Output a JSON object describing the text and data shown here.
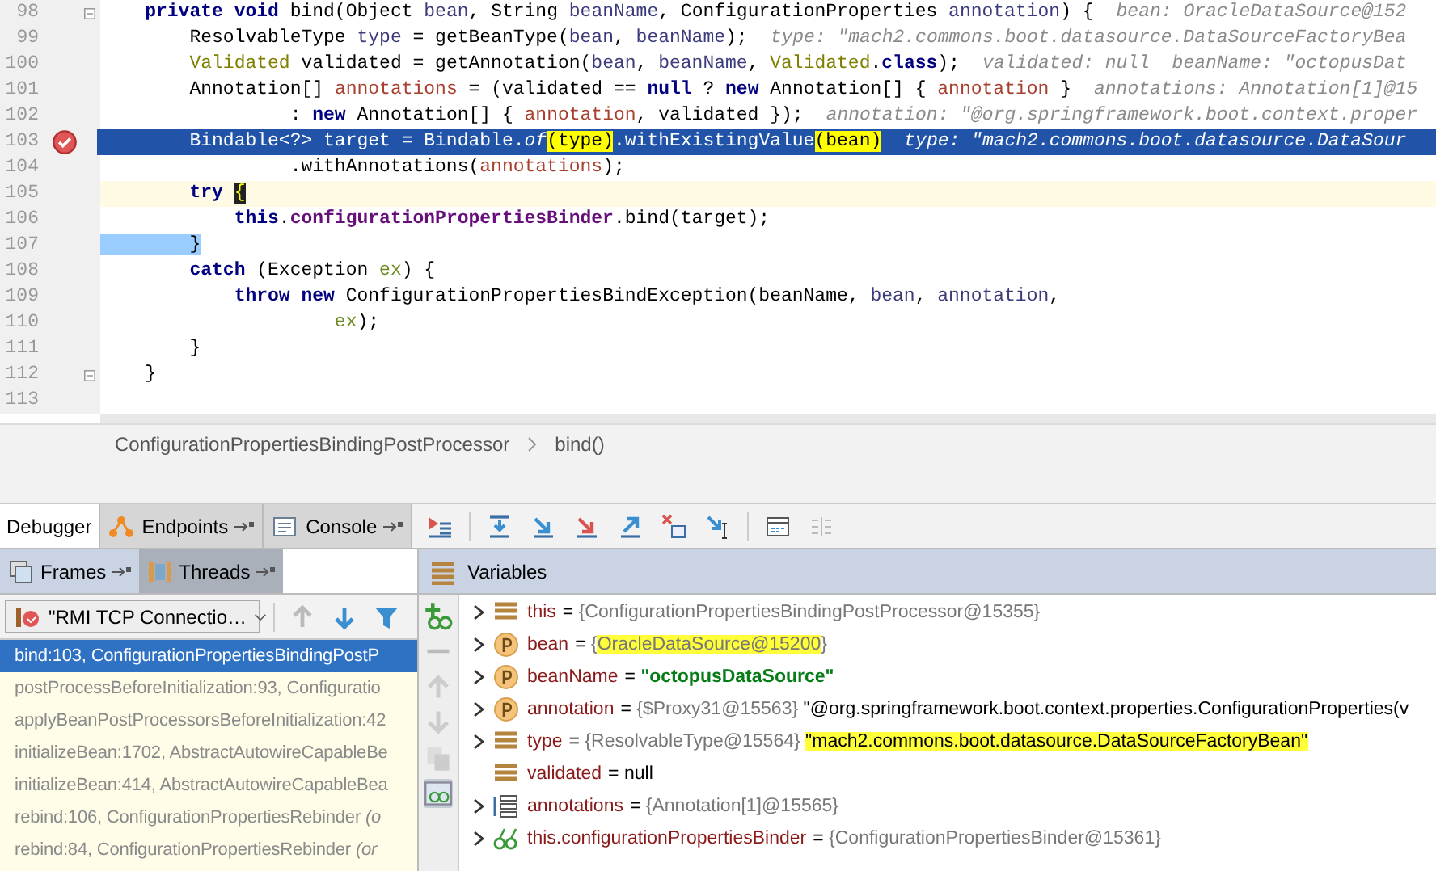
{
  "editor": {
    "lines": [
      {
        "number": "98",
        "breakpoint": false,
        "current": false,
        "caret": false,
        "fold": true,
        "tokens": [
          {
            "text": "    private void ",
            "kind": "kw"
          },
          {
            "text": "bind(Object ",
            "kind": "plain"
          },
          {
            "text": "bean",
            "kind": "param"
          },
          {
            "text": ", String ",
            "kind": "plain"
          },
          {
            "text": "beanName",
            "kind": "param"
          },
          {
            "text": ", ConfigurationProperties ",
            "kind": "plain"
          },
          {
            "text": "annotation",
            "kind": "param"
          },
          {
            "text": ") {",
            "kind": "plain"
          }
        ],
        "hint": "bean: OracleDataSource@152"
      },
      {
        "number": "99",
        "breakpoint": false,
        "current": false,
        "caret": false,
        "fold": false,
        "tokens": [
          {
            "text": "        ResolvableType ",
            "kind": "plain"
          },
          {
            "text": "type",
            "kind": "param"
          },
          {
            "text": " = getBeanType(",
            "kind": "plain"
          },
          {
            "text": "bean",
            "kind": "param"
          },
          {
            "text": ", ",
            "kind": "plain"
          },
          {
            "text": "beanName",
            "kind": "param"
          },
          {
            "text": ");",
            "kind": "plain"
          }
        ],
        "hint": "type: \"mach2.commons.boot.datasource.DataSourceFactoryBea"
      },
      {
        "number": "100",
        "breakpoint": false,
        "current": false,
        "caret": false,
        "fold": false,
        "tokens": [
          {
            "text": "        Validated",
            "kind": "annotation"
          },
          {
            "text": " validated = getAnnotation(",
            "kind": "plain"
          },
          {
            "text": "bean",
            "kind": "param"
          },
          {
            "text": ", ",
            "kind": "plain"
          },
          {
            "text": "beanName",
            "kind": "param"
          },
          {
            "text": ", ",
            "kind": "plain"
          },
          {
            "text": "Validated",
            "kind": "annotation"
          },
          {
            "text": ".",
            "kind": "plain"
          },
          {
            "text": "class",
            "kind": "kw"
          },
          {
            "text": ");",
            "kind": "plain"
          }
        ],
        "hint": "validated: null  beanName: \"octopusDat"
      },
      {
        "number": "101",
        "breakpoint": false,
        "current": false,
        "caret": false,
        "fold": false,
        "tokens": [
          {
            "text": "        Annotation[] ",
            "kind": "plain"
          },
          {
            "text": "annotations",
            "kind": "local"
          },
          {
            "text": " = (validated == ",
            "kind": "plain"
          },
          {
            "text": "null",
            "kind": "kw"
          },
          {
            "text": " ? ",
            "kind": "plain"
          },
          {
            "text": "new",
            "kind": "kw"
          },
          {
            "text": " Annotation[] { ",
            "kind": "plain"
          },
          {
            "text": "annotation",
            "kind": "local"
          },
          {
            "text": " }",
            "kind": "plain"
          }
        ],
        "hint": "annotations: Annotation[1]@15"
      },
      {
        "number": "102",
        "breakpoint": false,
        "current": false,
        "caret": false,
        "fold": false,
        "tokens": [
          {
            "text": "                 : ",
            "kind": "plain"
          },
          {
            "text": "new",
            "kind": "kw"
          },
          {
            "text": " Annotation[] { ",
            "kind": "plain"
          },
          {
            "text": "annotation",
            "kind": "local"
          },
          {
            "text": ", validated });",
            "kind": "plain"
          }
        ],
        "hint": "annotation: \"@org.springframework.boot.context.proper"
      },
      {
        "number": "103",
        "breakpoint": true,
        "current": true,
        "caret": false,
        "fold": false,
        "tokens": [
          {
            "text": "        Bindable<?> target = Bindable.",
            "kind": "plain"
          },
          {
            "text": "of",
            "kind": "static"
          },
          {
            "text": "(type)",
            "kind": "mark"
          },
          {
            "text": ".withExistingValue",
            "kind": "plain"
          },
          {
            "text": "(bean)",
            "kind": "mark"
          }
        ],
        "hint": "type: \"mach2.commons.boot.datasource.DataSour"
      },
      {
        "number": "104",
        "breakpoint": false,
        "current": false,
        "caret": false,
        "fold": false,
        "tokens": [
          {
            "text": "                 .withAnnotations(",
            "kind": "plain"
          },
          {
            "text": "annotations",
            "kind": "local"
          },
          {
            "text": ");",
            "kind": "plain"
          }
        ]
      },
      {
        "number": "105",
        "breakpoint": false,
        "current": false,
        "caret": true,
        "fold": false,
        "tokens": [
          {
            "text": "        try ",
            "kind": "kw"
          },
          {
            "text": "{",
            "kind": "caret"
          }
        ]
      },
      {
        "number": "106",
        "breakpoint": false,
        "current": false,
        "caret": false,
        "fold": false,
        "tokens": [
          {
            "text": "            this",
            "kind": "kw"
          },
          {
            "text": ".",
            "kind": "plain"
          },
          {
            "text": "configurationPropertiesBinder",
            "kind": "field"
          },
          {
            "text": ".bind(target);",
            "kind": "plain"
          }
        ]
      },
      {
        "number": "107",
        "breakpoint": false,
        "current": false,
        "caret": false,
        "fold": false,
        "tokens": [
          {
            "text": "        }",
            "kind": "match"
          }
        ]
      },
      {
        "number": "108",
        "breakpoint": false,
        "current": false,
        "caret": false,
        "fold": false,
        "tokens": [
          {
            "text": "        catch",
            "kind": "kw"
          },
          {
            "text": " (Exception ",
            "kind": "plain"
          },
          {
            "text": "ex",
            "kind": "catch"
          },
          {
            "text": ") {",
            "kind": "plain"
          }
        ]
      },
      {
        "number": "109",
        "breakpoint": false,
        "current": false,
        "caret": false,
        "fold": false,
        "tokens": [
          {
            "text": "            throw new",
            "kind": "kw"
          },
          {
            "text": " ConfigurationPropertiesBindException(beanName, ",
            "kind": "plain"
          },
          {
            "text": "bean",
            "kind": "param"
          },
          {
            "text": ", ",
            "kind": "plain"
          },
          {
            "text": "annotation",
            "kind": "param"
          },
          {
            "text": ",",
            "kind": "plain"
          }
        ]
      },
      {
        "number": "110",
        "breakpoint": false,
        "current": false,
        "caret": false,
        "fold": false,
        "tokens": [
          {
            "text": "                     ex",
            "kind": "catch"
          },
          {
            "text": ");",
            "kind": "plain"
          }
        ]
      },
      {
        "number": "111",
        "breakpoint": false,
        "current": false,
        "caret": false,
        "fold": false,
        "tokens": [
          {
            "text": "        }",
            "kind": "plain"
          }
        ]
      },
      {
        "number": "112",
        "breakpoint": false,
        "current": false,
        "caret": false,
        "fold": true,
        "tokens": [
          {
            "text": "    }",
            "kind": "plain"
          }
        ]
      },
      {
        "number": "113",
        "breakpoint": false,
        "current": false,
        "caret": false,
        "fold": false
      }
    ]
  },
  "breadcrumb": [
    "ConfigurationPropertiesBindingPostProcessor",
    "bind()"
  ],
  "debug_tabs": [
    {
      "label": "Debugger",
      "selected": true
    },
    {
      "label": "Endpoints",
      "selected": false
    },
    {
      "label": "Console",
      "selected": false
    }
  ],
  "frames_tabs": [
    {
      "label": "Frames",
      "selected": true
    },
    {
      "label": "Threads",
      "selected": false
    }
  ],
  "variables_title": "Variables",
  "thread_dropdown": "\"RMI TCP Connectio…",
  "frames": [
    {
      "text": "bind:103, ConfigurationPropertiesBindingPostP",
      "selected": true
    },
    {
      "text": "postProcessBeforeInitialization:93, Configuratio",
      "selected": false
    },
    {
      "text": "applyBeanPostProcessorsBeforeInitialization:42",
      "selected": false
    },
    {
      "text": "initializeBean:1702, AbstractAutowireCapableBe",
      "selected": false
    },
    {
      "text": "initializeBean:414, AbstractAutowireCapableBea",
      "selected": false
    },
    {
      "text": "rebind:106, ConfigurationPropertiesRebinder *(o*",
      "selected": false
    },
    {
      "text": "rebind:84, ConfigurationPropertiesRebinder *(or*",
      "selected": false
    }
  ],
  "variables": [
    {
      "name": "this",
      "kind": "field",
      "expandable": true,
      "value": [
        {
          "text": "= ",
          "kind": "plain",
          "marked": false
        },
        {
          "text": "{ConfigurationPropertiesBindingPostProcessor@15355}",
          "kind": "ref",
          "marked": false
        }
      ]
    },
    {
      "name": "bean",
      "kind": "param",
      "expandable": true,
      "value": [
        {
          "text": "= ",
          "kind": "plain",
          "marked": false
        },
        {
          "text": "{",
          "kind": "ref",
          "marked": false
        },
        {
          "text": "OracleDataSource@15200",
          "kind": "ref",
          "marked": true
        },
        {
          "text": "}",
          "kind": "ref",
          "marked": false
        }
      ]
    },
    {
      "name": "beanName",
      "kind": "param",
      "expandable": true,
      "value": [
        {
          "text": "= ",
          "kind": "plain",
          "marked": false
        },
        {
          "text": "\"octopusDataSource\"",
          "kind": "string",
          "marked": false
        }
      ]
    },
    {
      "name": "annotation",
      "kind": "param",
      "expandable": true,
      "value": [
        {
          "text": "= ",
          "kind": "plain",
          "marked": false
        },
        {
          "text": "{$Proxy31@15563} ",
          "kind": "ref",
          "marked": false
        },
        {
          "text": "\"@org.springframework.boot.context.properties.ConfigurationProperties(v",
          "kind": "plain",
          "marked": false
        }
      ]
    },
    {
      "name": "type",
      "kind": "field",
      "expandable": true,
      "value": [
        {
          "text": "= ",
          "kind": "plain",
          "marked": false
        },
        {
          "text": "{ResolvableType@15564} ",
          "kind": "ref",
          "marked": false
        },
        {
          "text": "\"mach2.commons.boot.datasource.DataSourceFactoryBean\"",
          "kind": "plain",
          "marked": true
        }
      ]
    },
    {
      "name": "validated",
      "kind": "field",
      "expandable": false,
      "value": [
        {
          "text": "= ",
          "kind": "plain",
          "marked": false
        },
        {
          "text": "null",
          "kind": "plain",
          "marked": false
        }
      ]
    },
    {
      "name": "annotations",
      "kind": "array",
      "expandable": true,
      "value": [
        {
          "text": "= ",
          "kind": "plain",
          "marked": false
        },
        {
          "text": "{Annotation[1]@15565}",
          "kind": "ref",
          "marked": false
        }
      ]
    },
    {
      "name": "this.configurationPropertiesBinder",
      "kind": "watch",
      "expandable": true,
      "value": [
        {
          "text": "= ",
          "kind": "plain",
          "marked": false
        },
        {
          "text": "{ConfigurationPropertiesBinder@15361}",
          "kind": "ref",
          "marked": false
        }
      ]
    }
  ]
}
